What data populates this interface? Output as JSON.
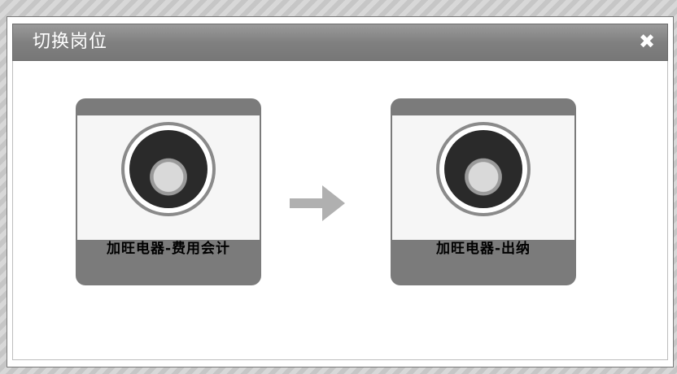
{
  "dialog": {
    "title": "切换岗位",
    "close_glyph": "✖",
    "close_icon": "close-icon"
  },
  "roles": [
    {
      "label": "加旺电器-费用会计",
      "avatar_icon": "user-avatar-icon"
    },
    {
      "label": "加旺电器-出纳",
      "avatar_icon": "user-avatar-icon"
    }
  ],
  "arrow_icon": "arrow-right-icon",
  "colors": {
    "titlebar": "#808080",
    "card": "#7b7b7b",
    "arrow": "#b0b0b0"
  }
}
